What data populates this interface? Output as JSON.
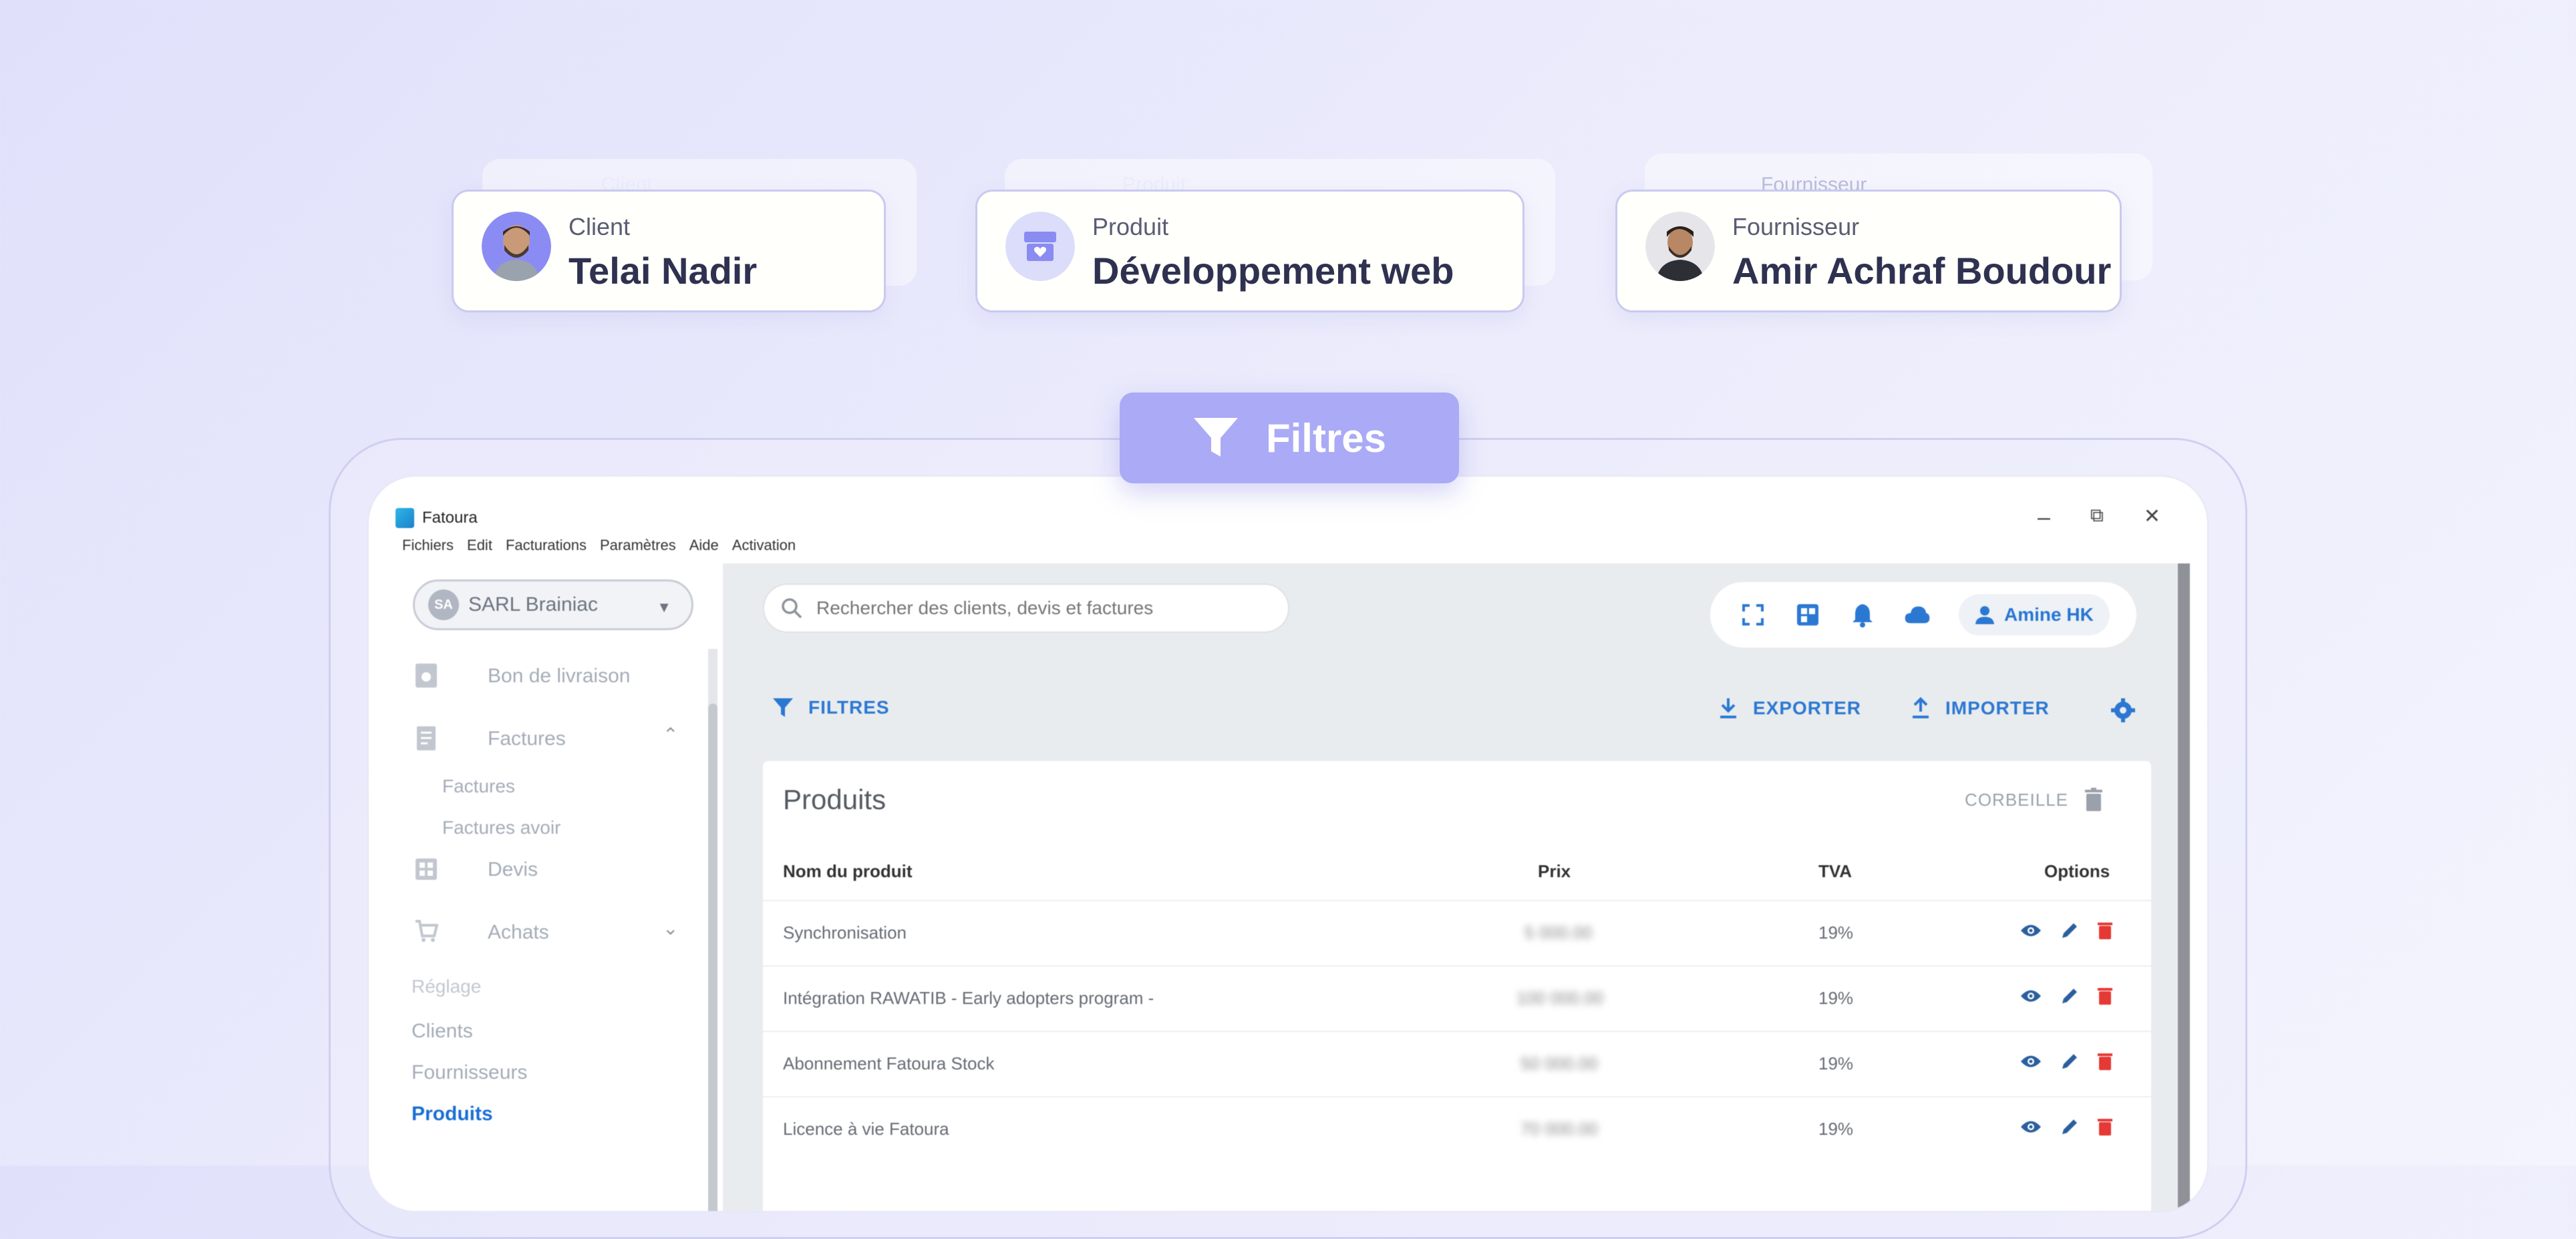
{
  "cards": [
    {
      "label": "Client",
      "value": "Telai Nadir",
      "ghost_label": "Client"
    },
    {
      "label": "Produit",
      "value": "Développement web",
      "ghost_label": "Produit"
    },
    {
      "label": "Fournisseur",
      "value": "Amir Achraf Boudour",
      "ghost_label": "Fournisseur"
    }
  ],
  "filter_badge": {
    "label": "Filtres"
  },
  "app": {
    "name": "Fatoura",
    "menu": [
      "Fichiers",
      "Edit",
      "Facturations",
      "Paramètres",
      "Aide",
      "Activation"
    ],
    "window_controls": {
      "minimize": "–",
      "restore": "⧉",
      "close": "✕"
    }
  },
  "sidebar": {
    "company": {
      "initials": "SA",
      "name": "SARL Brainiac"
    },
    "items": [
      {
        "label": "Bon de livraison",
        "icon": "receipt-icon"
      },
      {
        "label": "Factures",
        "icon": "invoice-icon",
        "expanded": true
      },
      {
        "label": "Factures"
      },
      {
        "label": "Factures avoir"
      },
      {
        "label": "Devis",
        "icon": "grid-icon"
      },
      {
        "label": "Achats",
        "icon": "cart-icon",
        "expanded": false
      }
    ],
    "section_label": "Réglage",
    "links": [
      "Clients",
      "Fournisseurs",
      "Produits"
    ],
    "active": "Produits"
  },
  "header": {
    "search_placeholder": "Rechercher des clients, devis et factures",
    "user": "Amine HK"
  },
  "actions": {
    "filters": "FILTRES",
    "export": "EXPORTER",
    "import": "IMPORTER"
  },
  "products": {
    "title": "Produits",
    "trash_label": "CORBEILLE",
    "columns": [
      "Nom du produit",
      "Prix",
      "TVA",
      "Options"
    ],
    "rows": [
      {
        "name": "Synchronisation",
        "price": "5 000.00",
        "tva": "19%"
      },
      {
        "name": "Intégration RAWATIB - Early adopters program -",
        "price": "100 000.00",
        "tva": "19%"
      },
      {
        "name": "Abonnement Fatoura Stock",
        "price": "50 000.00",
        "tva": "19%"
      },
      {
        "name": "Licence à vie Fatoura",
        "price": "70 000.00",
        "tva": "19%"
      }
    ]
  },
  "colors": {
    "accent": "#aaaaf6",
    "link_blue": "#2b78d3",
    "danger": "#e53935",
    "heading": "#2f3150"
  }
}
